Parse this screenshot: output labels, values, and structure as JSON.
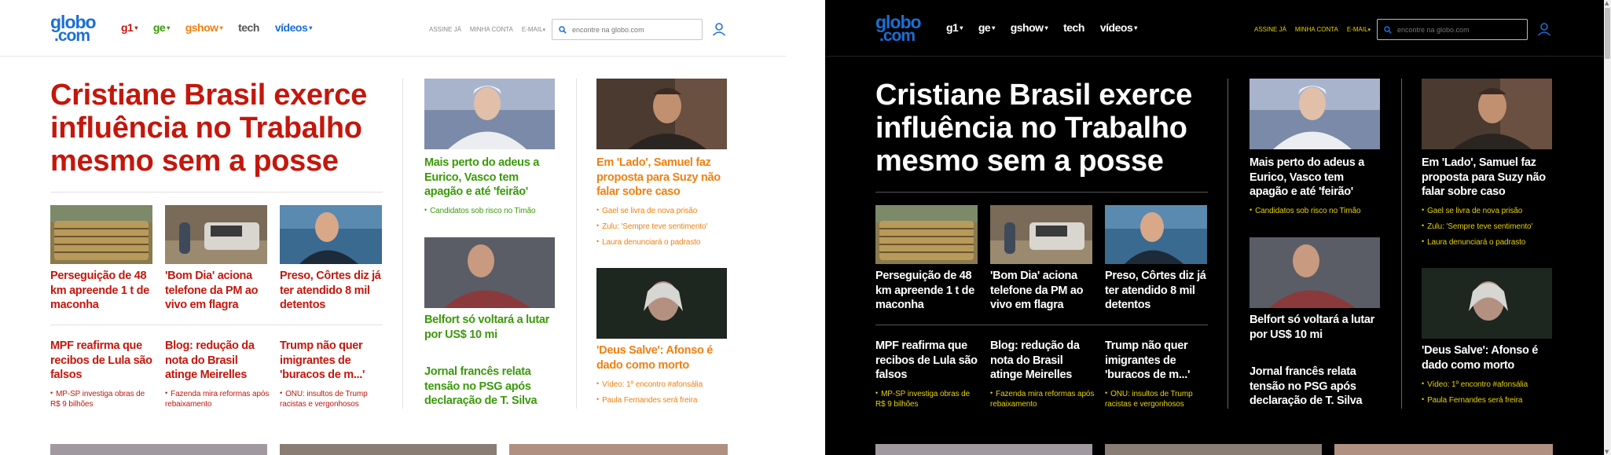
{
  "logo": {
    "line1": "globo",
    "line2": ".com"
  },
  "nav": [
    {
      "label": "g1"
    },
    {
      "label": "ge"
    },
    {
      "label": "gshow"
    },
    {
      "label": "tech"
    },
    {
      "label": "vídeos"
    }
  ],
  "toplinks": [
    "ASSINE JÁ",
    "MINHA CONTA",
    "E-MAIL"
  ],
  "search": {
    "placeholder": "encontre na globo.com"
  },
  "main": {
    "headline": "Cristiane Brasil exerce influência no Trabalho mesmo sem a posse",
    "row1": [
      {
        "title": "Perseguição de 48 km apreende 1 t de maconha"
      },
      {
        "title": "'Bom Dia' aciona telefone da PM ao vivo em flagra"
      },
      {
        "title": "Preso, Côrtes diz já ter atendido 8 mil detentos"
      }
    ],
    "row2": [
      {
        "title": "MPF reafirma que recibos de Lula são falsos",
        "sub": "MP-SP investiga obras de R$ 9 bilhões"
      },
      {
        "title": "Blog: redução da nota do Brasil atinge Meirelles",
        "sub": "Fazenda mira reformas após rebaixamento"
      },
      {
        "title": "Trump não quer imigrantes de 'buracos de m...'",
        "sub": "ONU: insultos de Trump racistas e vergonhosos"
      }
    ]
  },
  "col2": {
    "story1": {
      "title": "Mais perto do adeus a Eurico, Vasco tem apagão e até 'feirão'",
      "subs": [
        "Candidatos sob risco no Timão"
      ]
    },
    "story2": {
      "title": "Belfort só voltará a lutar por US$ 10 mi"
    },
    "story3": {
      "title": "Jornal francês relata tensão no PSG após declaração de T. Silva"
    }
  },
  "col3": {
    "story1": {
      "title": "Em 'Lado', Samuel faz proposta para Suzy não falar sobre caso",
      "subs": [
        "Gael se livra de nova prisão",
        "Zulu: 'Sempre teve sentimento'",
        "Laura denunciará o padrasto"
      ]
    },
    "story2": {
      "title": "'Deus Salve': Afonso é dado como morto",
      "subs": [
        "Vídeo: 1º encontro #afonsália",
        "Paula Fernandes será freira"
      ]
    }
  },
  "colors": {
    "g1_red": "#c4170c",
    "ge_green": "#3a9a0a",
    "gshow_orange": "#f08010",
    "brand_blue": "#1a6fd6",
    "dark_link_yellow": "#e6d200"
  },
  "icons": [
    "search-icon",
    "user-icon",
    "chevron-down-icon"
  ]
}
